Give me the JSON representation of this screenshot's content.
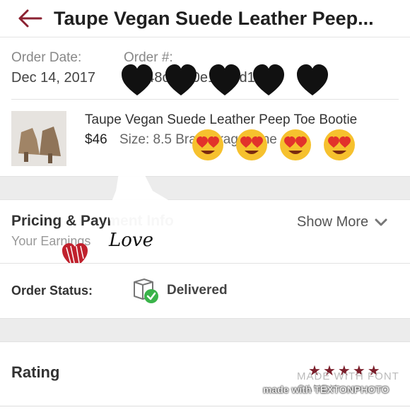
{
  "header": {
    "back_icon": "left-arrow-icon",
    "title": "Taupe Vegan Suede Leather Peep..."
  },
  "order": {
    "date_label": "Order Date:",
    "date_value": "Dec 14, 2017",
    "number_label": "Order #:",
    "number_value": "5c348c27c0e13e7d1f4d"
  },
  "item": {
    "title": "Taupe Vegan Suede Leather Peep Toe Bootie",
    "price": "$46",
    "size_text": "Size: 8.5  Brand: rag&bone"
  },
  "pricing": {
    "title": "Pricing & Payment Info",
    "subtitle": "Your Earnings",
    "show_more": "Show More"
  },
  "sticker": {
    "love_text": "Love"
  },
  "status": {
    "label": "Order Status:",
    "value": "Delivered",
    "status_color": "#3ab44a"
  },
  "rating": {
    "label": "Rating",
    "stars": 5,
    "star_color": "#7b1f2b"
  },
  "watermarks": {
    "made_with": "MADE WITH FONT CANDY",
    "textonphoto": "made with TEXTONPHOTO"
  },
  "colors": {
    "accent": "#8b2131"
  }
}
